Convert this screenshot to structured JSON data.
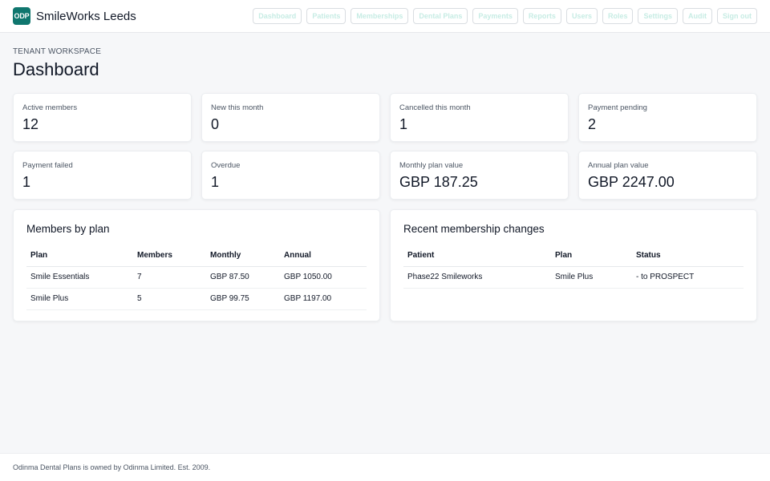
{
  "header": {
    "logo_text": "ODP",
    "brand": "SmileWorks Leeds",
    "nav": [
      "Dashboard",
      "Patients",
      "Memberships",
      "Dental Plans",
      "Payments",
      "Reports",
      "Users",
      "Roles",
      "Settings",
      "Audit",
      "Sign out"
    ]
  },
  "page": {
    "eyebrow": "TENANT WORKSPACE",
    "title": "Dashboard"
  },
  "stats": [
    {
      "label": "Active members",
      "value": "12"
    },
    {
      "label": "New this month",
      "value": "0"
    },
    {
      "label": "Cancelled this month",
      "value": "1"
    },
    {
      "label": "Payment pending",
      "value": "2"
    },
    {
      "label": "Payment failed",
      "value": "1"
    },
    {
      "label": "Overdue",
      "value": "1"
    },
    {
      "label": "Monthly plan value",
      "value": "GBP 187.25"
    },
    {
      "label": "Annual plan value",
      "value": "GBP 2247.00"
    }
  ],
  "members_by_plan": {
    "title": "Members by plan",
    "columns": [
      "Plan",
      "Members",
      "Monthly",
      "Annual"
    ],
    "rows": [
      [
        "Smile Essentials",
        "7",
        "GBP 87.50",
        "GBP 1050.00"
      ],
      [
        "Smile Plus",
        "5",
        "GBP 99.75",
        "GBP 1197.00"
      ]
    ]
  },
  "recent_changes": {
    "title": "Recent membership changes",
    "columns": [
      "Patient",
      "Plan",
      "Status"
    ],
    "rows": [
      [
        "Phase22 Smileworks",
        "Smile Plus",
        "- to PROSPECT"
      ]
    ]
  },
  "footer": {
    "text": "Odinma Dental Plans is owned by Odinma Limited. Est. 2009."
  },
  "colors": {
    "brand": "#0f766e",
    "nav_text": "#c7ece4",
    "background": "#f6f7f9"
  }
}
